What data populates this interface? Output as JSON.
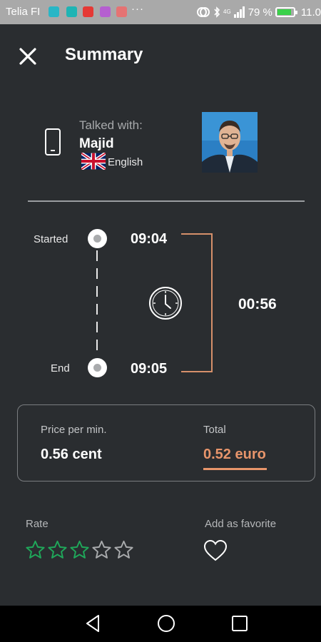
{
  "status_bar": {
    "carrier": "Telia FI",
    "dots": "···",
    "signal_label": "4G",
    "battery_percent": "79 %",
    "time": "11.0",
    "app_icon_colors": [
      "#29b6c6",
      "#1fb4b4",
      "#e53935",
      "#b55fd0",
      "#e57373"
    ]
  },
  "header": {
    "title": "Summary"
  },
  "contact": {
    "talked_label": "Talked with:",
    "name": "Majid",
    "language": "English"
  },
  "timeline": {
    "started_label": "Started",
    "start_time": "09:04",
    "end_label": "End",
    "end_time": "09:05",
    "duration": "00:56"
  },
  "pricing": {
    "price_label": "Price per min.",
    "price_value": "0.56 cent",
    "total_label": "Total",
    "total_value": "0.52 euro"
  },
  "rating": {
    "label": "Rate",
    "value": 3,
    "max": 5,
    "filled_color": "#1fa85a",
    "empty_color": "#a9abad"
  },
  "favorite": {
    "label": "Add as favorite"
  },
  "colors": {
    "background": "#2a2d30",
    "accent": "#e8956b",
    "status_bar": "#a9a9a9"
  }
}
